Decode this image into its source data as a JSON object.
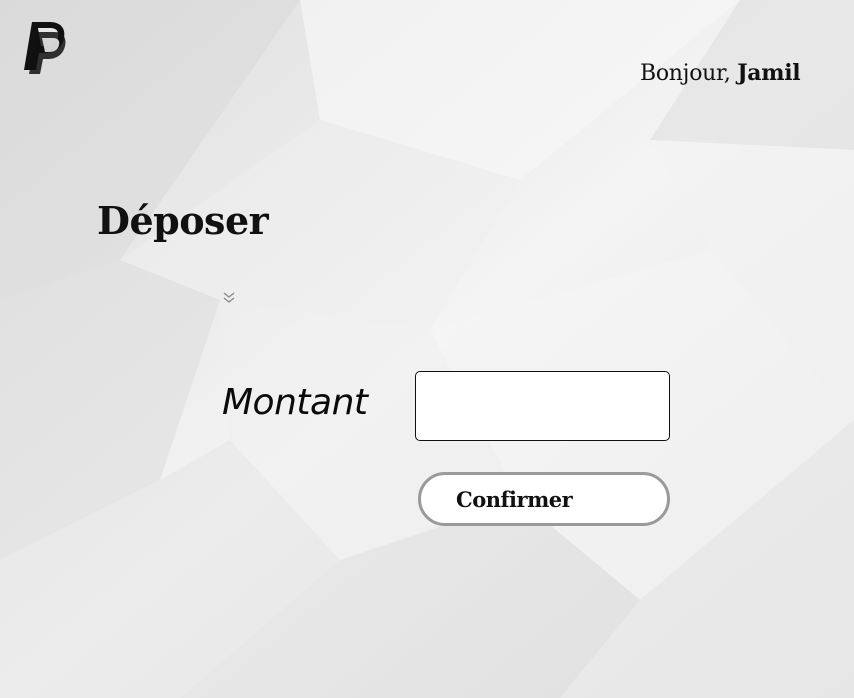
{
  "header": {
    "logo_icon": "paypal-logo-icon",
    "greeting_prefix": "Bonjour, ",
    "user_name": "Jamil"
  },
  "main": {
    "title": "Déposer",
    "toggle_icon": "chevron-double-down-icon",
    "amount_label": "Montant",
    "amount_value": "",
    "confirm_label": "Confirmer"
  },
  "colors": {
    "background": "#e8e8e8",
    "text": "#111111",
    "button_border": "#9a9a9a",
    "input_border": "#111111"
  }
}
